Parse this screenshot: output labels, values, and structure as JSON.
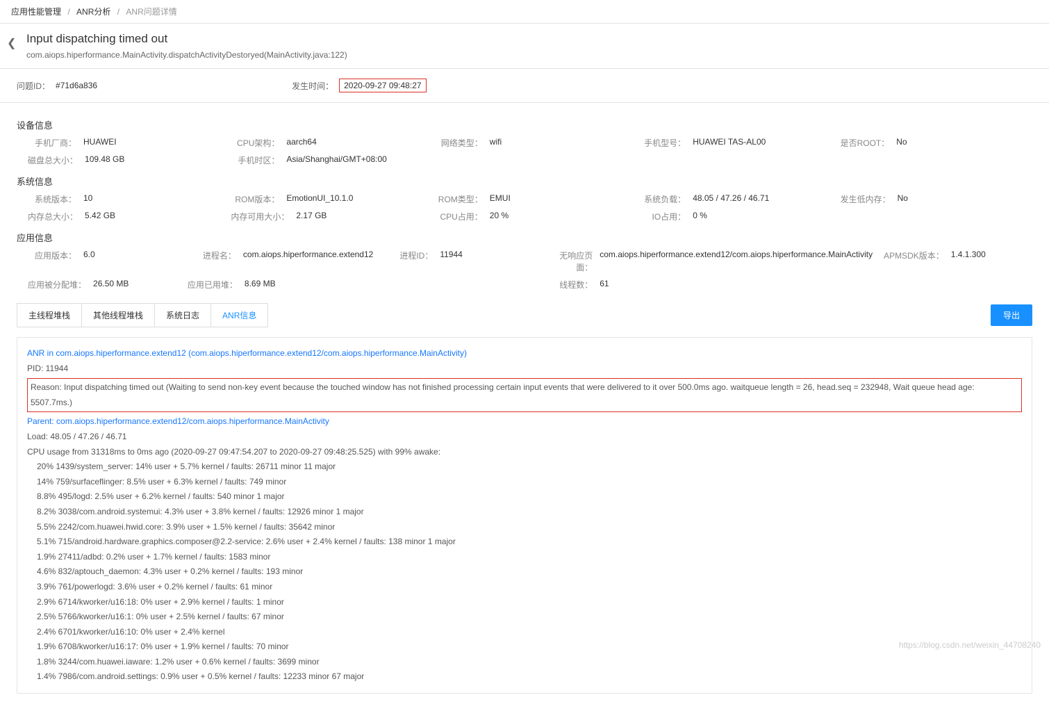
{
  "breadcrumb": {
    "lvl1": "应用性能管理",
    "lvl2": "ANR分析",
    "lvl3": "ANR问题详情"
  },
  "header": {
    "title": "Input dispatching timed out",
    "subtitle": "com.aiops.hiperformance.MainActivity.dispatchActivityDestoryed(MainActivity.java:122)"
  },
  "meta": {
    "issue_id_label": "问题ID：",
    "issue_id": "#71d6a836",
    "time_label": "发生时间：",
    "time": "2020-09-27 09:48:27"
  },
  "sections": {
    "device_title": "设备信息",
    "device": [
      {
        "l": "手机厂商：",
        "v": "HUAWEI"
      },
      {
        "l": "CPU架构：",
        "v": "aarch64"
      },
      {
        "l": "网络类型：",
        "v": "wifi"
      },
      {
        "l": "手机型号：",
        "v": "HUAWEI TAS-AL00"
      },
      {
        "l": "是否ROOT：",
        "v": "No"
      },
      {
        "l": "磁盘总大小：",
        "v": "109.48 GB"
      },
      {
        "l": "手机时区：",
        "v": "Asia/Shanghai/GMT+08:00"
      },
      {
        "l": "",
        "v": ""
      },
      {
        "l": "",
        "v": ""
      },
      {
        "l": "",
        "v": ""
      }
    ],
    "system_title": "系统信息",
    "system": [
      {
        "l": "系统版本：",
        "v": "10"
      },
      {
        "l": "ROM版本：",
        "v": "EmotionUI_10.1.0"
      },
      {
        "l": "ROM类型：",
        "v": "EMUI"
      },
      {
        "l": "系统负载：",
        "v": "48.05 / 47.26 / 46.71"
      },
      {
        "l": "发生低内存：",
        "v": "No"
      },
      {
        "l": "内存总大小：",
        "v": "5.42 GB"
      },
      {
        "l": "内存可用大小：",
        "v": "2.17 GB"
      },
      {
        "l": "CPU占用：",
        "v": "20 %"
      },
      {
        "l": "IO占用：",
        "v": "0 %"
      },
      {
        "l": "",
        "v": ""
      }
    ],
    "app_title": "应用信息",
    "app": [
      {
        "l": "应用版本：",
        "v": "6.0"
      },
      {
        "l": "进程名：",
        "v": "com.aiops.hiperformance.extend12"
      },
      {
        "l": "进程ID：",
        "v": "11944"
      },
      {
        "l": "无响应页面：",
        "v": "com.aiops.hiperformance.extend12/com.aiops.hiperformance.MainActivity"
      },
      {
        "l": "APMSDK版本：",
        "v": "1.4.1.300"
      },
      {
        "l": "应用被分配堆：",
        "v": "26.50 MB"
      },
      {
        "l": "应用已用堆：",
        "v": "8.69 MB"
      },
      {
        "l": "",
        "v": ""
      },
      {
        "l": "线程数：",
        "v": "61"
      },
      {
        "l": "",
        "v": ""
      }
    ]
  },
  "tabs": {
    "t1": "主线程堆栈",
    "t2": "其他线程堆栈",
    "t3": "系统日志",
    "t4": "ANR信息",
    "export": "导出"
  },
  "anr": {
    "title": "ANR in com.aiops.hiperformance.extend12 (com.aiops.hiperformance.extend12/com.aiops.hiperformance.MainActivity)",
    "pid": "PID: 11944",
    "reason": "Reason: Input dispatching timed out (Waiting to send non-key event because the touched window has not finished processing certain input events that were delivered to it over 500.0ms ago. waitqueue length = 26, head.seq = 232948, Wait queue head age: 5507.7ms.)",
    "parent": "Parent: com.aiops.hiperformance.extend12/com.aiops.hiperformance.MainActivity",
    "load": "Load: 48.05 / 47.26 / 46.71",
    "cpu_header": "CPU usage from 31318ms to 0ms ago (2020-09-27 09:47:54.207 to 2020-09-27 09:48:25.525) with 99% awake:",
    "lines": [
      "20% 1439/system_server: 14% user + 5.7% kernel / faults: 26711 minor 11 major",
      "14% 759/surfaceflinger: 8.5% user + 6.3% kernel / faults: 749 minor",
      "8.8% 495/logd: 2.5% user + 6.2% kernel / faults: 540 minor 1 major",
      "8.2% 3038/com.android.systemui: 4.3% user + 3.8% kernel / faults: 12926 minor 1 major",
      "5.5% 2242/com.huawei.hwid.core: 3.9% user + 1.5% kernel / faults: 35642 minor",
      "5.1% 715/android.hardware.graphics.composer@2.2-service: 2.6% user + 2.4% kernel / faults: 138 minor 1 major",
      "1.9% 27411/adbd: 0.2% user + 1.7% kernel / faults: 1583 minor",
      "4.6% 832/aptouch_daemon: 4.3% user + 0.2% kernel / faults: 193 minor",
      "3.9% 761/powerlogd: 3.6% user + 0.2% kernel / faults: 61 minor",
      "2.9% 6714/kworker/u16:18: 0% user + 2.9% kernel / faults: 1 minor",
      "2.5% 5766/kworker/u16:1: 0% user + 2.5% kernel / faults: 67 minor",
      "2.4% 6701/kworker/u16:10: 0% user + 2.4% kernel",
      "1.9% 6708/kworker/u16:17: 0% user + 1.9% kernel / faults: 70 minor",
      "1.8% 3244/com.huawei.iaware: 1.2% user + 0.6% kernel / faults: 3699 minor",
      "1.4% 7986/com.android.settings: 0.9% user + 0.5% kernel / faults: 12233 minor 67 major"
    ]
  },
  "watermark": "https://blog.csdn.net/weixin_44708240"
}
